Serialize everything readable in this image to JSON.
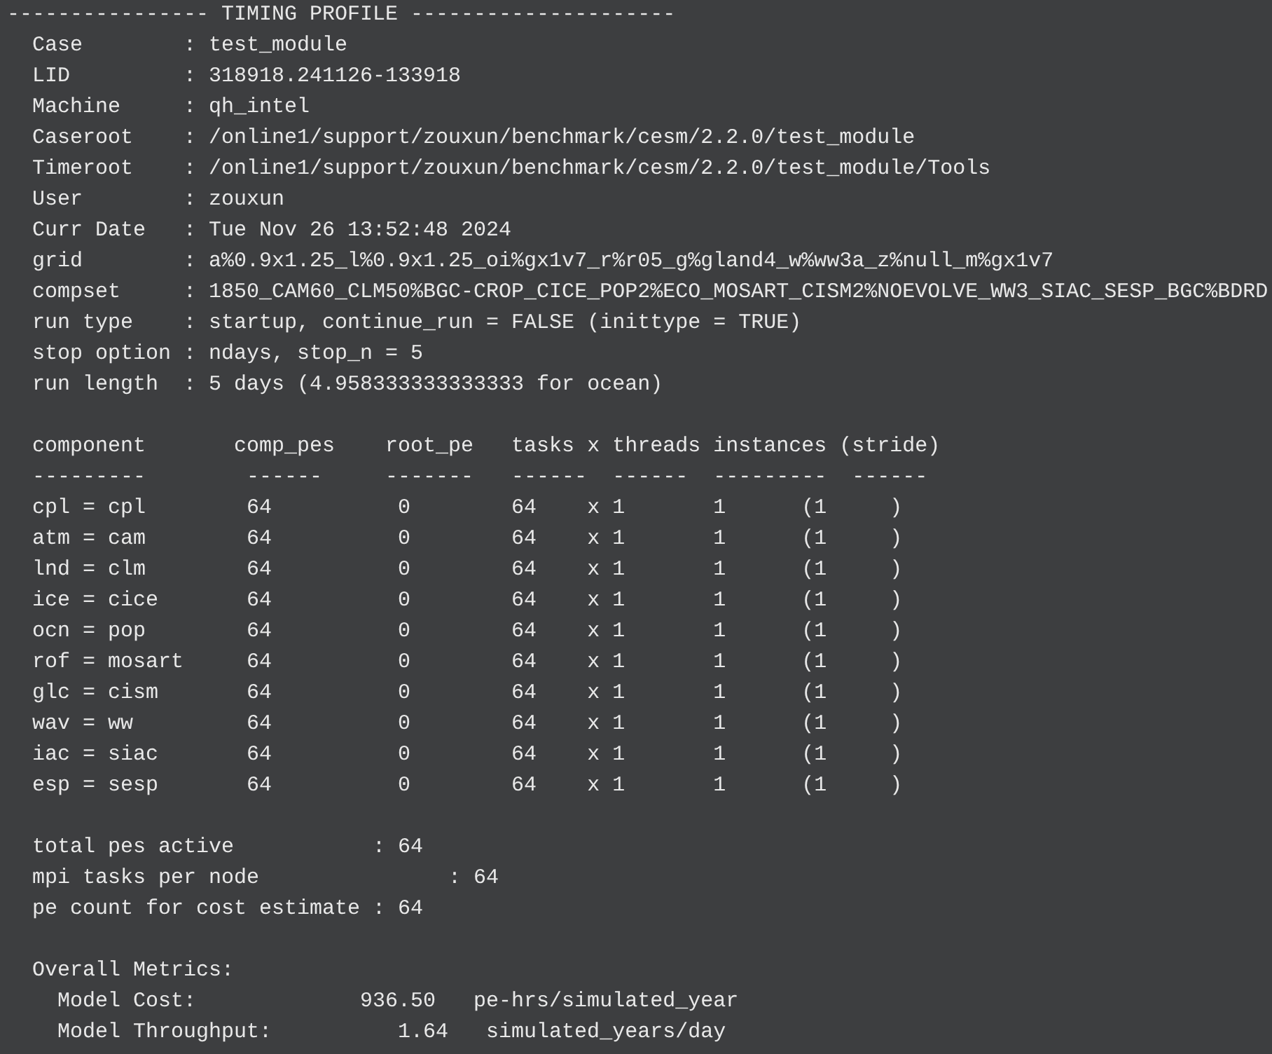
{
  "title_line": "---------------- TIMING PROFILE ---------------------",
  "info_lines": [
    "Case        : test_module",
    "LID         : 318918.241126-133918",
    "Machine     : qh_intel",
    "Caseroot    : /online1/support/zouxun/benchmark/cesm/2.2.0/test_module",
    "Timeroot    : /online1/support/zouxun/benchmark/cesm/2.2.0/test_module/Tools",
    "User        : zouxun",
    "Curr Date   : Tue Nov 26 13:52:48 2024",
    "grid        : a%0.9x1.25_l%0.9x1.25_oi%gx1v7_r%r05_g%gland4_w%ww3a_z%null_m%gx1v7",
    "compset     : 1850_CAM60_CLM50%BGC-CROP_CICE_POP2%ECO_MOSART_CISM2%NOEVOLVE_WW3_SIAC_SESP_BGC%BDRD",
    "run type    : startup, continue_run = FALSE (inittype = TRUE)",
    "stop option : ndays, stop_n = 5",
    "run length  : 5 days (4.958333333333333 for ocean)"
  ],
  "table": {
    "columns": [
      "component",
      "comp_pes",
      "root_pe",
      "tasks",
      "x threads",
      "instances",
      "(stride)"
    ],
    "rules": [
      "---------",
      "------",
      "-------",
      "------",
      "------",
      "---------",
      "------"
    ],
    "rows": [
      [
        "cpl = cpl",
        "64",
        "0",
        "64",
        "x 1",
        "1",
        "(1     )"
      ],
      [
        "atm = cam",
        "64",
        "0",
        "64",
        "x 1",
        "1",
        "(1     )"
      ],
      [
        "lnd = clm",
        "64",
        "0",
        "64",
        "x 1",
        "1",
        "(1     )"
      ],
      [
        "ice = cice",
        "64",
        "0",
        "64",
        "x 1",
        "1",
        "(1     )"
      ],
      [
        "ocn = pop",
        "64",
        "0",
        "64",
        "x 1",
        "1",
        "(1     )"
      ],
      [
        "rof = mosart",
        "64",
        "0",
        "64",
        "x 1",
        "1",
        "(1     )"
      ],
      [
        "glc = cism",
        "64",
        "0",
        "64",
        "x 1",
        "1",
        "(1     )"
      ],
      [
        "wav = ww",
        "64",
        "0",
        "64",
        "x 1",
        "1",
        "(1     )"
      ],
      [
        "iac = siac",
        "64",
        "0",
        "64",
        "x 1",
        "1",
        "(1     )"
      ],
      [
        "esp = sesp",
        "64",
        "0",
        "64",
        "x 1",
        "1",
        "(1     )"
      ]
    ]
  },
  "summary_lines": [
    "total pes active           : 64",
    "mpi tasks per node               : 64",
    "pe count for cost estimate : 64"
  ],
  "metrics": {
    "title": "Overall Metrics:",
    "lines": [
      "Model Cost:             936.50   pe-hrs/simulated_year",
      "Model Throughput:          1.64   simulated_years/day"
    ]
  }
}
